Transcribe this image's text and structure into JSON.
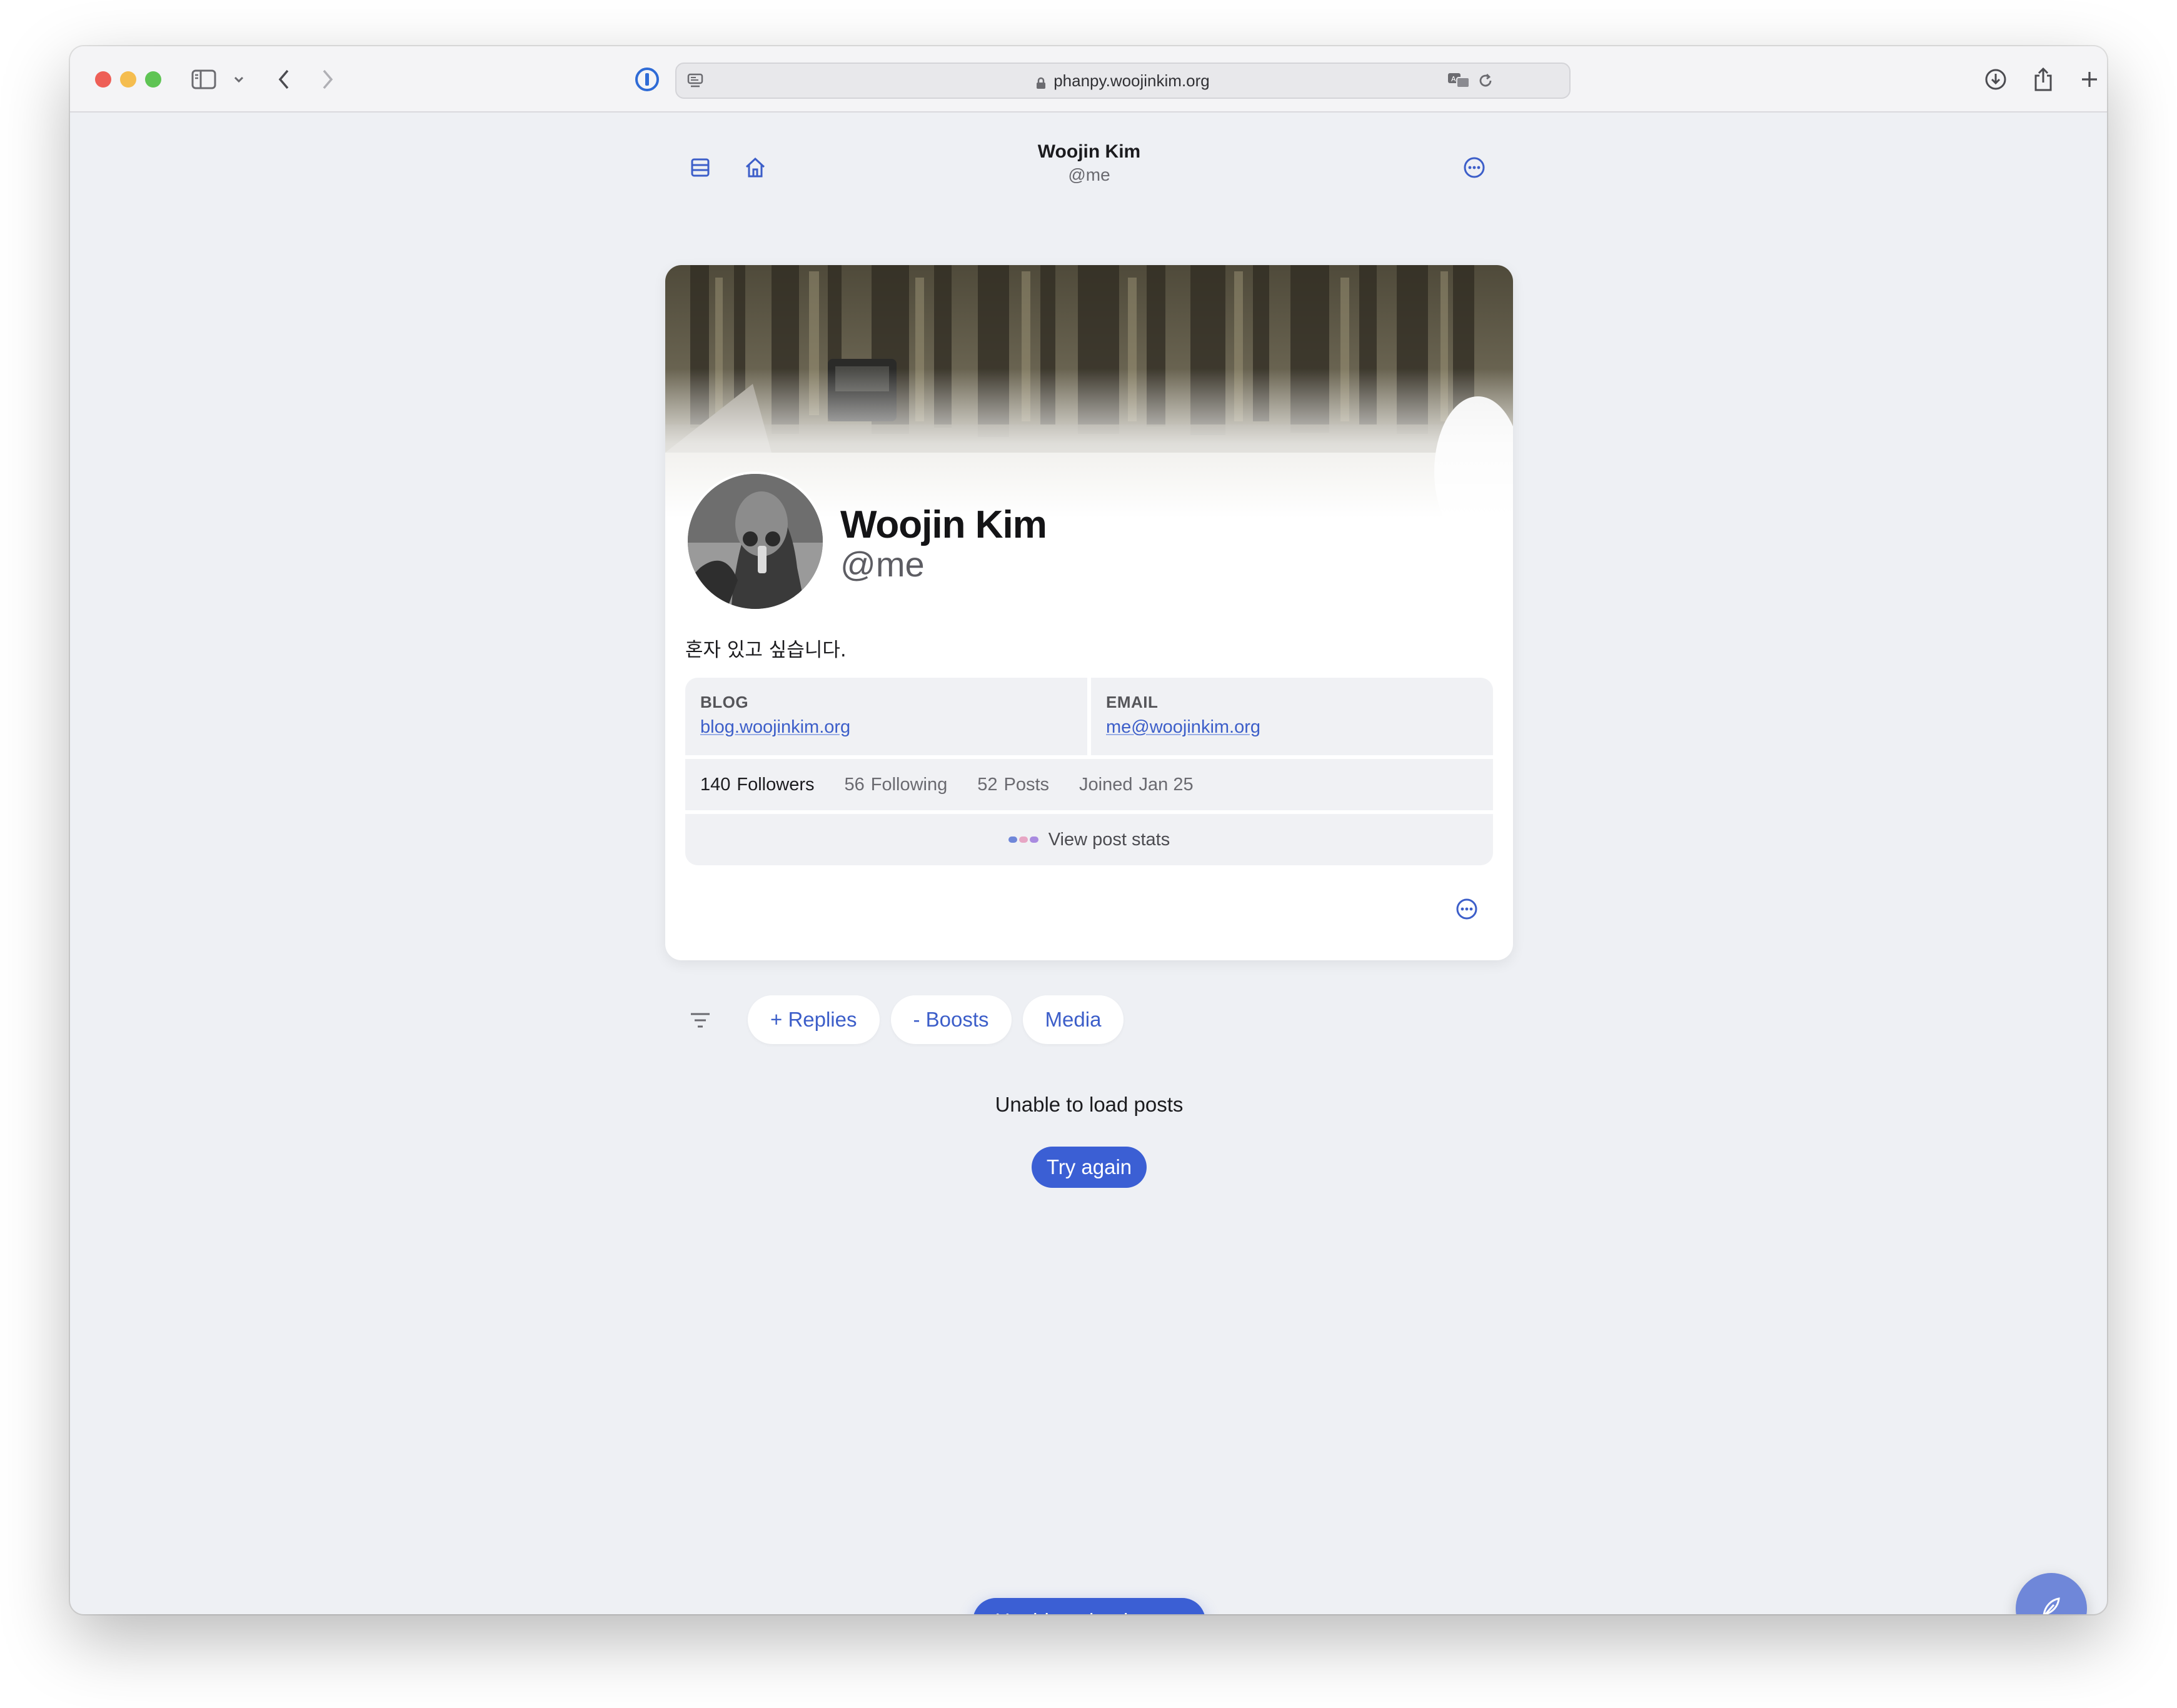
{
  "browser": {
    "url": "phanpy.woojinkim.org",
    "icons": [
      "sidebar-icon",
      "chevron-down-icon",
      "back-icon",
      "forward-icon",
      "password-manager-icon",
      "reader-icon",
      "lock-icon",
      "translate-icon",
      "reload-icon",
      "download-icon",
      "share-icon",
      "new-tab-icon",
      "tabs-overview-icon"
    ]
  },
  "header": {
    "title": "Woojin Kim",
    "subtitle": "@me",
    "icons": [
      "timeline-icon",
      "home-icon",
      "more-icon"
    ]
  },
  "profile": {
    "name": "Woojin Kim",
    "handle": "@me",
    "bio": "혼자 있고 싶습니다.",
    "fields": [
      {
        "label": "BLOG",
        "value": "blog.woojinkim.org"
      },
      {
        "label": "EMAIL",
        "value": "me@woojinkim.org"
      }
    ],
    "stats": {
      "followers_count": "140",
      "followers_label": "Followers",
      "following_count": "56",
      "following_label": "Following",
      "posts_count": "52",
      "posts_label": "Posts",
      "joined_label": "Joined",
      "joined_date": "Jan 25"
    },
    "post_stats_label": "View post stats"
  },
  "filters": {
    "items": [
      {
        "label": "+ Replies"
      },
      {
        "label": "- Boosts"
      },
      {
        "label": "Media"
      }
    ]
  },
  "status": {
    "message": "Unable to load posts",
    "retry_label": "Try again",
    "toast": "Unable to load posts"
  },
  "colors": {
    "accent": "#3b5fd4",
    "link": "#3c5ec9",
    "page_bg": "#eef0f4",
    "compose_button": "#6f87d9"
  }
}
